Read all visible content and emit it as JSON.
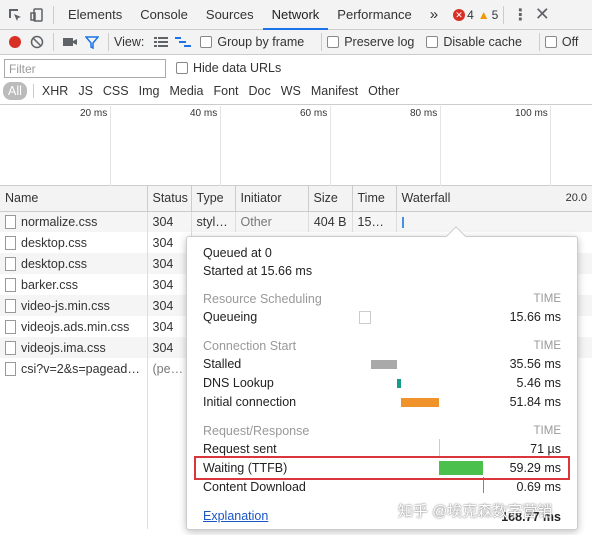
{
  "tabs": {
    "items": [
      "Elements",
      "Console",
      "Sources",
      "Network",
      "Performance"
    ],
    "more": "»",
    "errors": "4",
    "warnings": "5"
  },
  "toolbar": {
    "view_label": "View:",
    "group_by_frame": "Group by frame",
    "preserve_log": "Preserve log",
    "disable_cache": "Disable cache",
    "offline": "Off"
  },
  "filter": {
    "placeholder": "Filter",
    "hide_data_urls": "Hide data URLs",
    "types": [
      "All",
      "XHR",
      "JS",
      "CSS",
      "Img",
      "Media",
      "Font",
      "Doc",
      "WS",
      "Manifest",
      "Other"
    ]
  },
  "overview": {
    "ticks": [
      "20 ms",
      "40 ms",
      "60 ms",
      "80 ms",
      "100 ms"
    ]
  },
  "table": {
    "headers": {
      "name": "Name",
      "status": "Status",
      "type": "Type",
      "initiator": "Initiator",
      "size": "Size",
      "time": "Time",
      "waterfall": "Waterfall",
      "waterfall_right": "20.0"
    },
    "rows": [
      {
        "name": "normalize.css",
        "status": "304",
        "type": "styl…",
        "initiator": "Other",
        "size": "404 B",
        "time": "153…"
      },
      {
        "name": "desktop.css",
        "status": "304"
      },
      {
        "name": "desktop.css",
        "status": "304"
      },
      {
        "name": "barker.css",
        "status": "304"
      },
      {
        "name": "video-js.min.css",
        "status": "304"
      },
      {
        "name": "videojs.ads.min.css",
        "status": "304"
      },
      {
        "name": "videojs.ima.css",
        "status": "304"
      },
      {
        "name": "csi?v=2&s=pagead…",
        "status": "(pen…"
      }
    ]
  },
  "timing": {
    "queued_at": "Queued at 0",
    "started_at": "Started at 15.66 ms",
    "time_header": "TIME",
    "sections": {
      "scheduling": "Resource Scheduling",
      "connection": "Connection Start",
      "request": "Request/Response"
    },
    "queueing": {
      "label": "Queueing",
      "value": "15.66 ms"
    },
    "stalled": {
      "label": "Stalled",
      "value": "35.56 ms"
    },
    "dns": {
      "label": "DNS Lookup",
      "value": "5.46 ms"
    },
    "initial": {
      "label": "Initial connection",
      "value": "51.84 ms"
    },
    "request_sent": {
      "label": "Request sent",
      "value": "71 µs"
    },
    "waiting": {
      "label": "Waiting (TTFB)",
      "value": "59.29 ms"
    },
    "download": {
      "label": "Content Download",
      "value": "0.69 ms"
    },
    "total": "168.77 ms",
    "explanation": "Explanation"
  },
  "watermark": "知乎 @埃克森数字营销",
  "colors": {
    "stalled": "#a9a9a9",
    "dns": "#1a9a8c",
    "initial": "#f0932b",
    "waiting": "#4cc04c",
    "download": "#4a90e2",
    "highlight": "#d8363a"
  }
}
